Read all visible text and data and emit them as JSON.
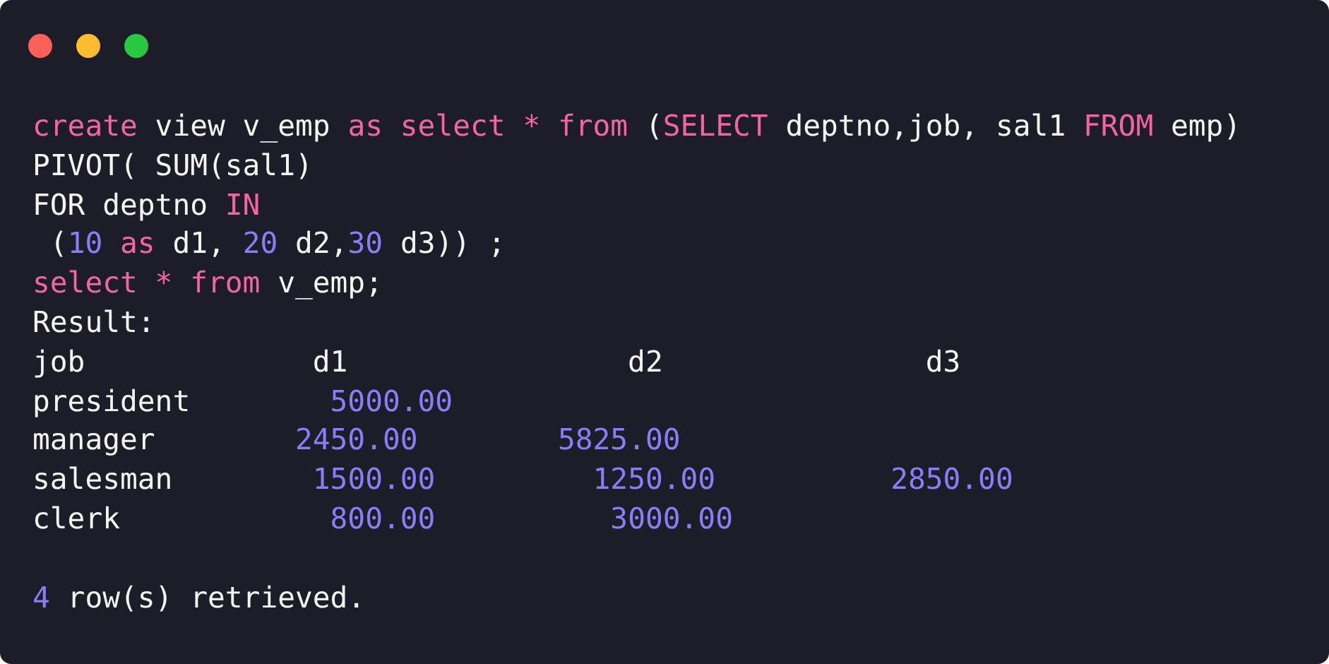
{
  "window": {
    "controls": [
      {
        "kind": "close"
      },
      {
        "kind": "minimize"
      },
      {
        "kind": "maximize"
      }
    ]
  },
  "code": {
    "lines": [
      {
        "tokens": [
          {
            "kind": "keyword",
            "text": "create"
          },
          {
            "kind": "plain",
            "text": " view v_emp "
          },
          {
            "kind": "keyword",
            "text": "as select * from"
          },
          {
            "kind": "plain",
            "text": " ("
          },
          {
            "kind": "keyword",
            "text": "SELECT"
          },
          {
            "kind": "plain",
            "text": " deptno,job, sal1 "
          },
          {
            "kind": "keyword",
            "text": "FROM"
          },
          {
            "kind": "plain",
            "text": " emp)"
          }
        ]
      },
      {
        "tokens": [
          {
            "kind": "plain",
            "text": "PIVOT( SUM(sal1)"
          }
        ]
      },
      {
        "tokens": [
          {
            "kind": "plain",
            "text": "FOR deptno "
          },
          {
            "kind": "keyword",
            "text": "IN"
          }
        ]
      },
      {
        "tokens": [
          {
            "kind": "plain",
            "text": " ("
          },
          {
            "kind": "number",
            "text": "10"
          },
          {
            "kind": "keyword",
            "text": " as"
          },
          {
            "kind": "plain",
            "text": " d1, "
          },
          {
            "kind": "number",
            "text": "20"
          },
          {
            "kind": "plain",
            "text": " d2,"
          },
          {
            "kind": "number",
            "text": "30"
          },
          {
            "kind": "plain",
            "text": " d3)) ;"
          }
        ]
      },
      {
        "tokens": [
          {
            "kind": "keyword",
            "text": "select * from"
          },
          {
            "kind": "plain",
            "text": " v_emp;"
          }
        ]
      },
      {
        "tokens": [
          {
            "kind": "plain",
            "text": "Result:"
          }
        ]
      },
      {
        "tokens": [
          {
            "kind": "plain",
            "text": "job             d1                d2               d3"
          }
        ]
      },
      {
        "tokens": [
          {
            "kind": "plain",
            "text": "president        "
          },
          {
            "kind": "number",
            "text": "5000.00"
          }
        ]
      },
      {
        "tokens": [
          {
            "kind": "plain",
            "text": "manager        "
          },
          {
            "kind": "number",
            "text": "2450.00"
          },
          {
            "kind": "number",
            "text": "        5825.00"
          }
        ]
      },
      {
        "tokens": [
          {
            "kind": "plain",
            "text": "salesman        "
          },
          {
            "kind": "number",
            "text": "1500.00"
          },
          {
            "kind": "number",
            "text": "         1250.00"
          },
          {
            "kind": "number",
            "text": "          2850.00"
          }
        ]
      },
      {
        "tokens": [
          {
            "kind": "plain",
            "text": "clerk            "
          },
          {
            "kind": "number",
            "text": "800.00"
          },
          {
            "kind": "number",
            "text": "          3000.00"
          }
        ]
      }
    ],
    "footer": {
      "tokens": [
        {
          "kind": "number",
          "text": "4"
        },
        {
          "kind": "plain",
          "text": " row(s) retrieved."
        }
      ]
    }
  }
}
